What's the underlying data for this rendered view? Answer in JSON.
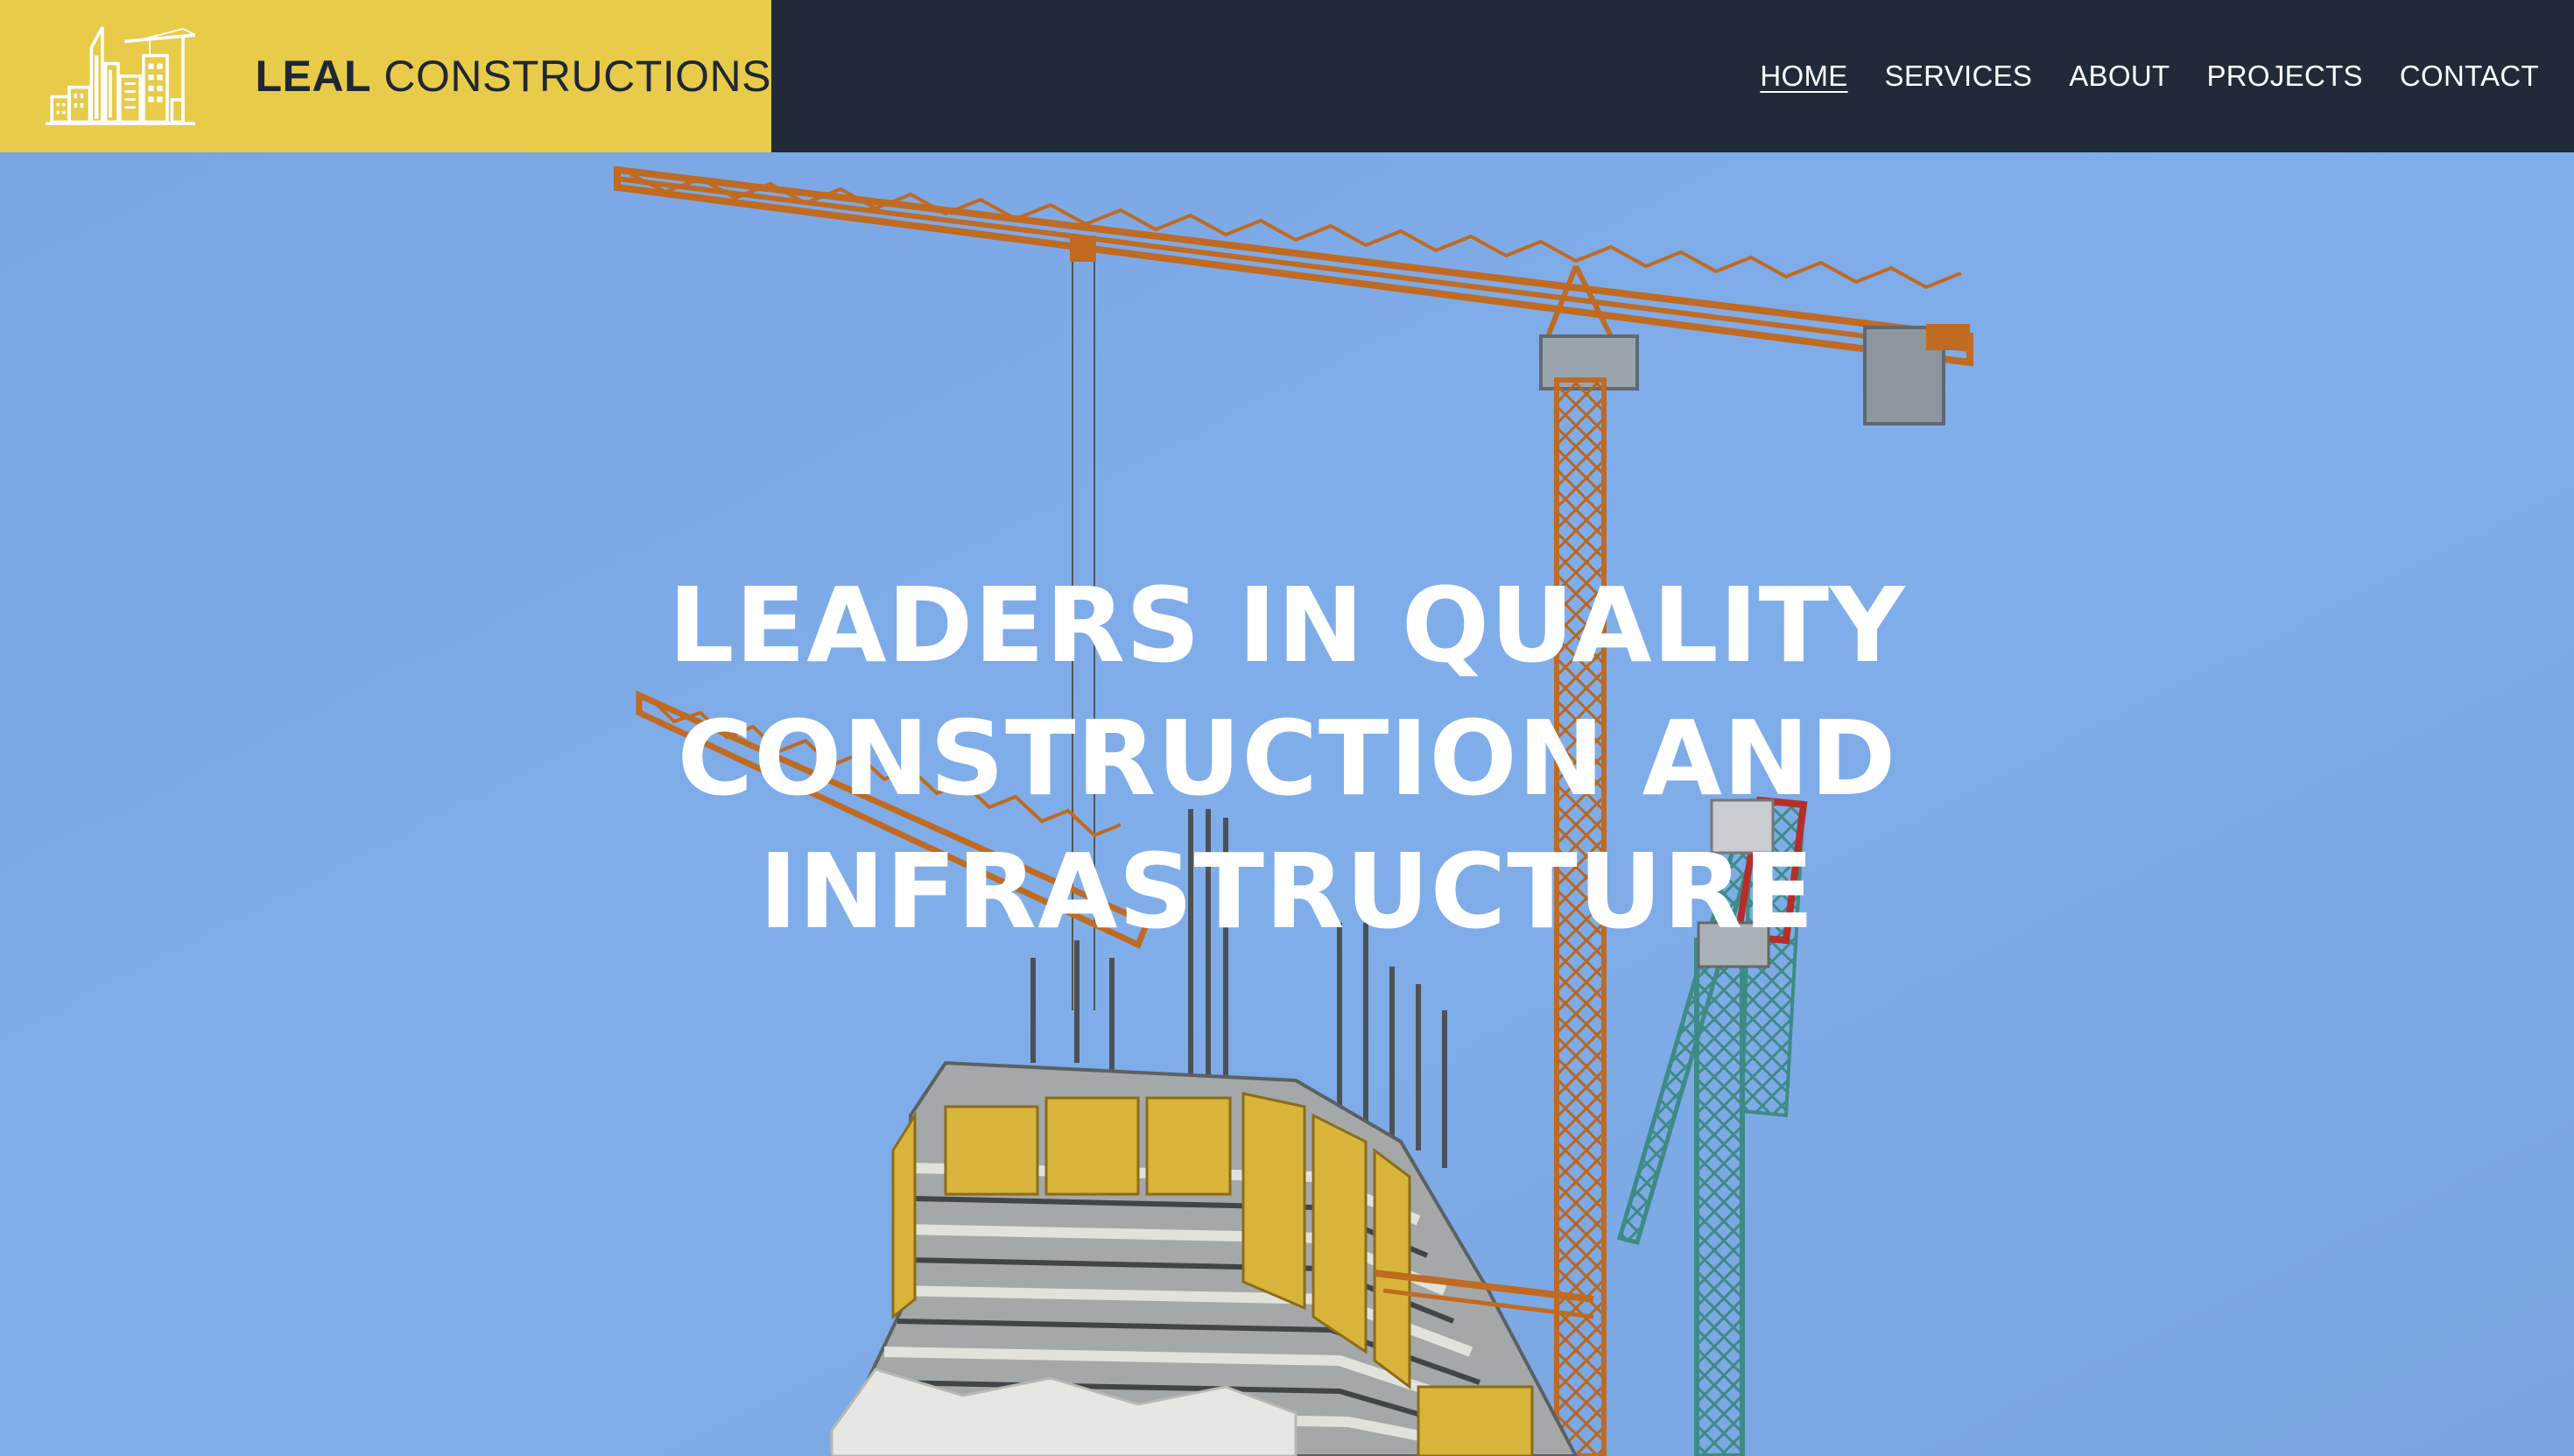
{
  "brand": {
    "name_bold": "LEAL",
    "name_light": "CONSTRUCTIONS",
    "logo_icon": "city-crane-logo-icon",
    "background_color": "#e8cb49"
  },
  "nav": {
    "items": [
      {
        "label": "HOME",
        "active": true
      },
      {
        "label": "SERVICES",
        "active": false
      },
      {
        "label": "ABOUT",
        "active": false
      },
      {
        "label": "PROJECTS",
        "active": false
      },
      {
        "label": "CONTACT",
        "active": false
      }
    ],
    "background_color": "#212a38"
  },
  "hero": {
    "title_lines": [
      "LEADERS IN QUALITY",
      "CONSTRUCTION AND",
      "INFRASTRUCTURE"
    ],
    "background_image": "construction-cranes-image",
    "sky_color": "#7ba7e2"
  }
}
